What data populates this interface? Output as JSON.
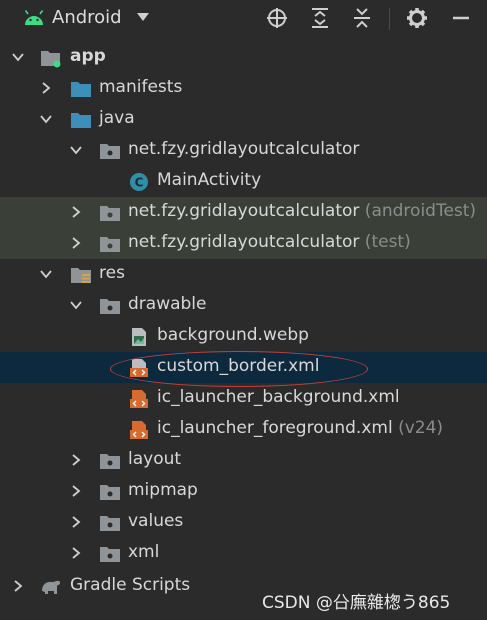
{
  "toolbar": {
    "title": "Android",
    "icons": [
      "android-icon",
      "dropdown-icon",
      "locate-icon",
      "expand-all-icon",
      "collapse-all-icon",
      "gear-icon",
      "minimize-icon"
    ]
  },
  "tree": [
    {
      "label": "app",
      "suffix": ""
    },
    {
      "label": "manifests",
      "suffix": ""
    },
    {
      "label": "java",
      "suffix": ""
    },
    {
      "label": "net.fzy.gridlayoutcalculator",
      "suffix": ""
    },
    {
      "label": "MainActivity",
      "suffix": ""
    },
    {
      "label": "net.fzy.gridlayoutcalculator",
      "suffix": " (androidTest)"
    },
    {
      "label": "net.fzy.gridlayoutcalculator",
      "suffix": " (test)"
    },
    {
      "label": "res",
      "suffix": ""
    },
    {
      "label": "drawable",
      "suffix": ""
    },
    {
      "label": "background.webp",
      "suffix": ""
    },
    {
      "label": "custom_border.xml",
      "suffix": ""
    },
    {
      "label": "ic_launcher_background.xml",
      "suffix": ""
    },
    {
      "label": "ic_launcher_foreground.xml",
      "suffix": " (v24)"
    },
    {
      "label": "layout",
      "suffix": ""
    },
    {
      "label": "mipmap",
      "suffix": ""
    },
    {
      "label": "values",
      "suffix": ""
    },
    {
      "label": "xml",
      "suffix": ""
    },
    {
      "label": "Gradle Scripts",
      "suffix": ""
    }
  ],
  "watermark": "CSDN @㕣廡雜楤う865",
  "colors": {
    "background": "#2b2b2b",
    "selected_row": "#0d293e",
    "test_row": "#3a4038",
    "folder_blue": "#3d8fb9",
    "package_gray": "#8e9498",
    "class_teal": "#2f8fa8",
    "xml_orange": "#d76b2f",
    "highlight_circle": "#c0413b",
    "muted_text": "#8c8c8c"
  }
}
